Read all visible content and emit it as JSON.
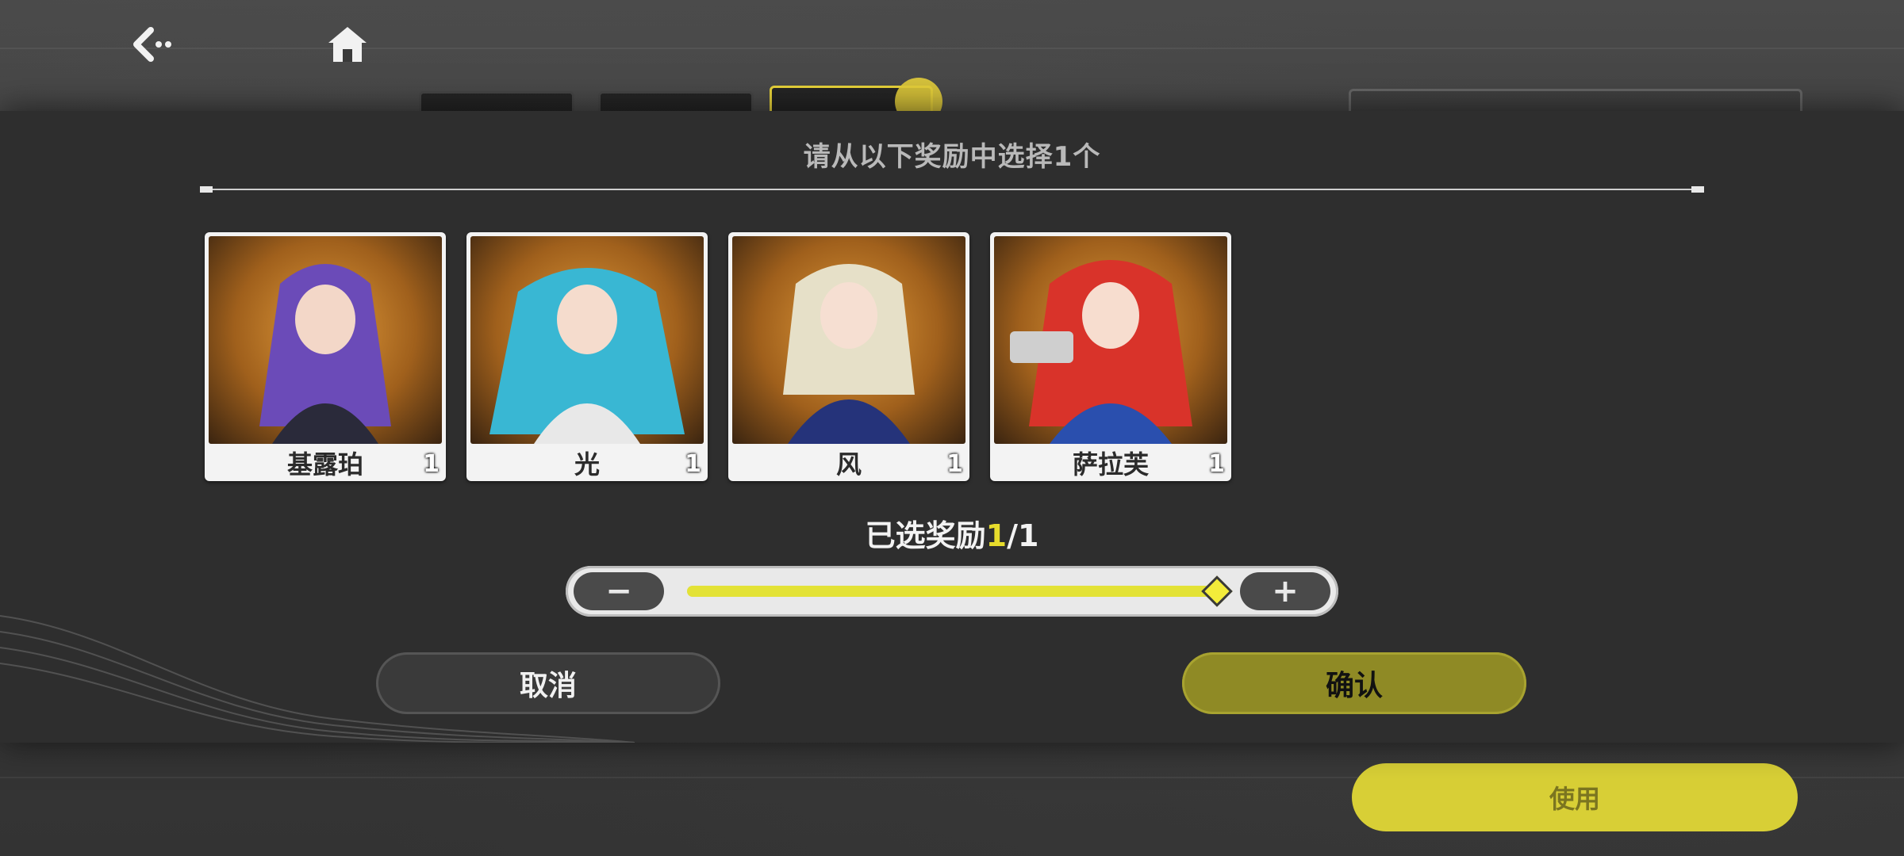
{
  "modal": {
    "title": "请从以下奖励中选择1个",
    "cards": [
      {
        "name": "基露珀",
        "count": "1",
        "hair": "#6b4bb8"
      },
      {
        "name": "光",
        "count": "1",
        "hair": "#39b7d3"
      },
      {
        "name": "风",
        "count": "1",
        "hair": "#e6e0c8"
      },
      {
        "name": "萨拉芙",
        "count": "1",
        "hair": "#d9332a"
      }
    ],
    "selected_label": "已选奖励",
    "selected_current": "1",
    "selected_sep": "/",
    "selected_total": "1",
    "slider": {
      "min_label": "−",
      "max_label": "+",
      "value": 1,
      "max": 1
    },
    "cancel_label": "取消",
    "confirm_label": "确认"
  },
  "background": {
    "use_label": "使用"
  },
  "icons": {
    "back": "back-arrow-icon",
    "home": "home-icon"
  },
  "colors": {
    "accent_yellow": "#e3e236",
    "confirm_olive": "#8f8a25",
    "card_bg_orange": "#e09a3a"
  }
}
